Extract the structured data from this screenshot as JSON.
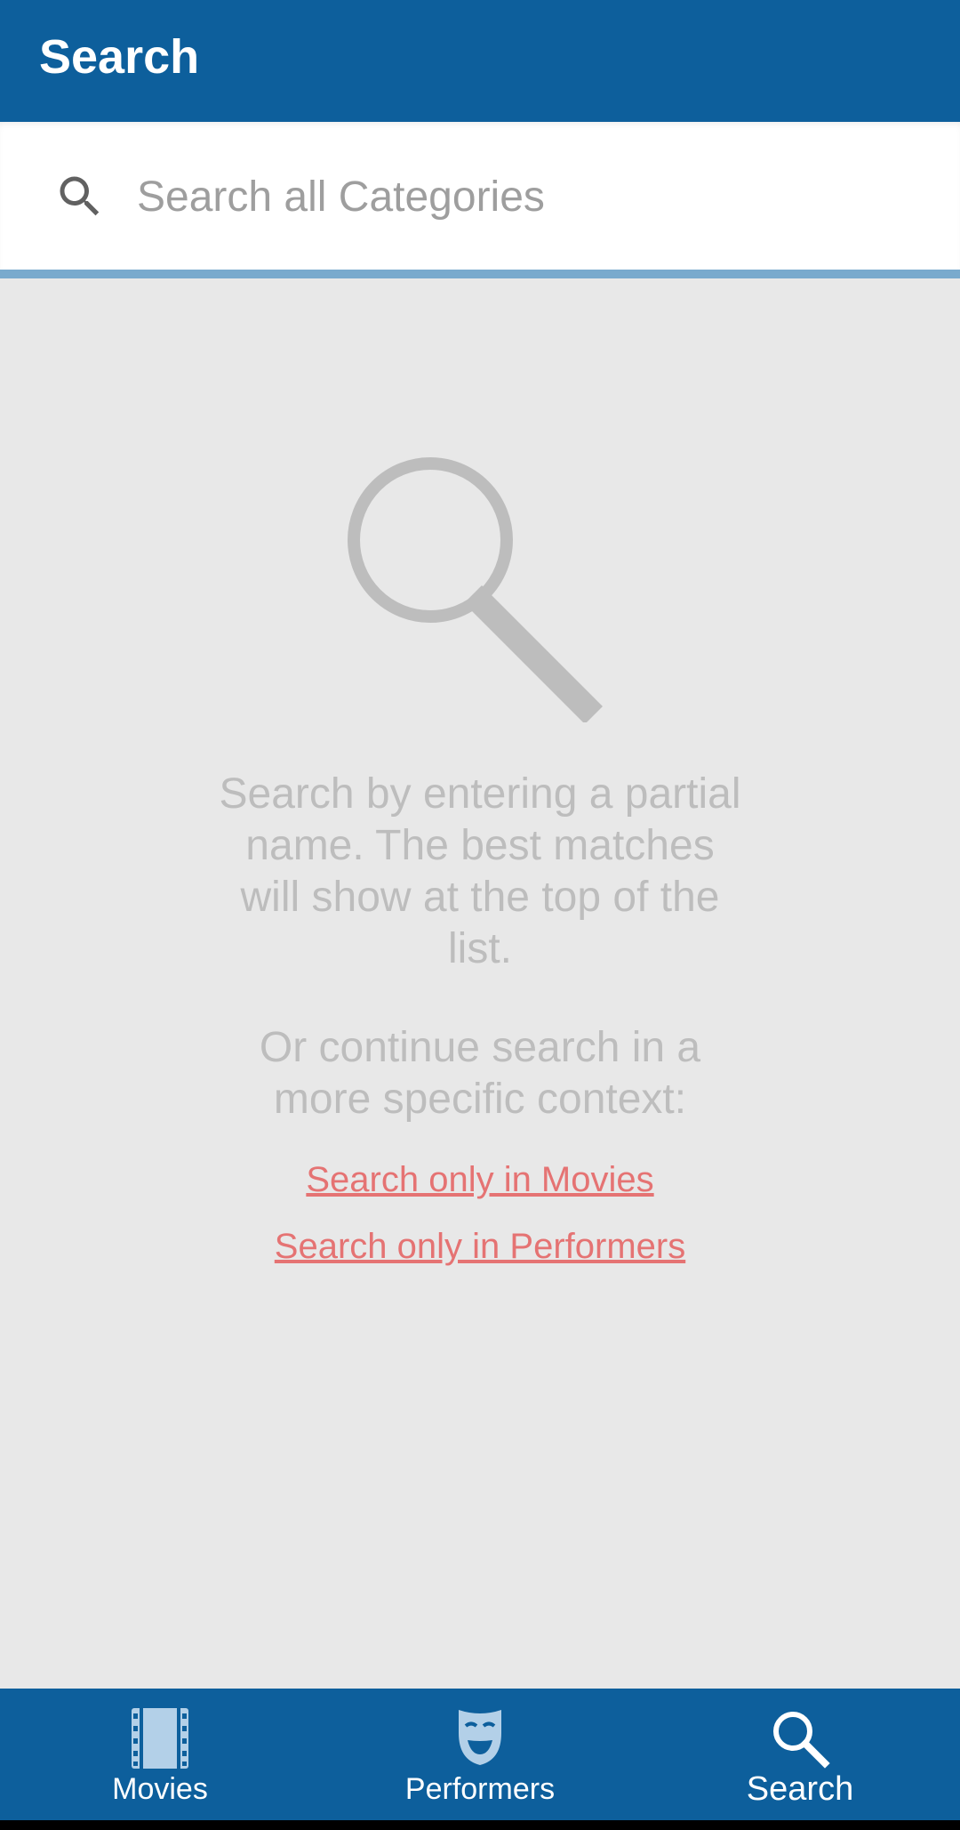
{
  "app_bar": {
    "title": "Search"
  },
  "search": {
    "placeholder": "Search all Categories",
    "value": "",
    "icon": "search-icon"
  },
  "empty_state": {
    "icon": "magnifier-illustration",
    "message": "Search by entering a partial name. The best matches will show at the top of the list.",
    "context_prompt": "Or continue search in a more specific context:",
    "links": [
      {
        "label": "Search only in Movies"
      },
      {
        "label": "Search only in Performers"
      }
    ]
  },
  "bottom_nav": {
    "items": [
      {
        "label": "Movies",
        "icon": "film-strip-icon",
        "active": false
      },
      {
        "label": "Performers",
        "icon": "theater-mask-icon",
        "active": false
      },
      {
        "label": "Search",
        "icon": "search-icon",
        "active": true
      }
    ]
  },
  "colors": {
    "primary": "#0d5f9c",
    "accent_underline": "#79aacd",
    "link": "#e57373",
    "muted_text": "#bdbdbd",
    "background": "#e8e8e8",
    "inactive_icon": "#b3d0e8"
  }
}
